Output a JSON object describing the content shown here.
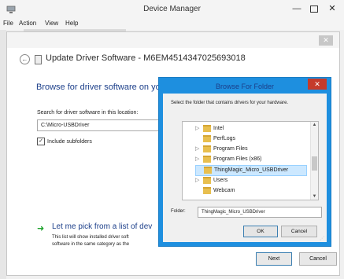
{
  "window": {
    "title": "Device Manager",
    "controls": {
      "minimize": "—",
      "close": "✕"
    },
    "menu": [
      "File",
      "Action",
      "View",
      "Help"
    ]
  },
  "wizard": {
    "close_glyph": "✕",
    "back_glyph": "←",
    "title": "Update Driver Software - M6EM4514347025693018",
    "heading": "Browse for driver software on yo",
    "search_label": "Search for driver software in this location:",
    "path_value": "C:\\Micro-USBDriver",
    "include_subfolders": {
      "label": "Include subfolders",
      "checked": true,
      "glyph": "✓"
    },
    "pick_arrow": "➜",
    "pick_title": "Let me pick from a list of dev",
    "pick_desc_line1": "This list will show installed driver soft",
    "pick_desc_line2": "software in the same category as the",
    "next_label": "Next",
    "cancel_label": "Cancel"
  },
  "browse_dialog": {
    "title": "Browse For Folder",
    "close_glyph": "✕",
    "instruction": "Select the folder that contains drivers for your hardware.",
    "tree": [
      {
        "label": "Intel",
        "expander": "▷",
        "selected": false
      },
      {
        "label": "PerfLogs",
        "expander": "",
        "selected": false
      },
      {
        "label": "Program Files",
        "expander": "▷",
        "selected": false
      },
      {
        "label": "Program Files (x86)",
        "expander": "▷",
        "selected": false
      },
      {
        "label": "ThingMagic_Micro_USBDriver",
        "expander": "",
        "selected": true
      },
      {
        "label": "Users",
        "expander": "▷",
        "selected": false
      },
      {
        "label": "Webcam",
        "expander": "",
        "selected": false
      }
    ],
    "scroll_up": "▲",
    "scroll_down": "▼",
    "folder_label": "Folder:",
    "folder_value": "ThingMagic_Micro_USBDriver",
    "ok_label": "OK",
    "cancel_label": "Cancel",
    "grip": "⋰"
  }
}
